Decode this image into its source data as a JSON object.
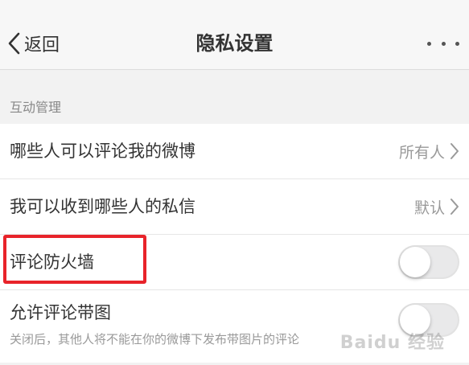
{
  "navbar": {
    "back_label": "返回",
    "title": "隐私设置",
    "more_icon": "ellipsis-icon"
  },
  "section": {
    "label": "互动管理"
  },
  "rows": [
    {
      "label": "哪些人可以评论我的微博",
      "value": "所有人"
    },
    {
      "label": "我可以收到哪些人的私信",
      "value": "默认"
    },
    {
      "label": "评论防火墙",
      "toggle": false
    },
    {
      "label": "允许评论带图",
      "description": "关闭后，其他人将不能在你的微博下发布带图片的评论",
      "toggle": false
    }
  ],
  "annotation": {
    "highlight_color": "#e8232a"
  },
  "watermark": {
    "text": "Baidu 经验"
  }
}
